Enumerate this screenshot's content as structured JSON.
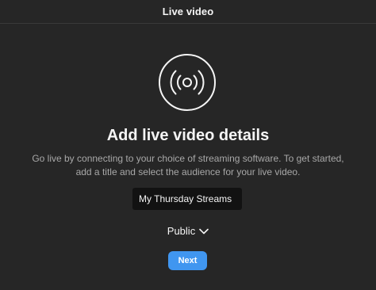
{
  "header": {
    "title": "Live video"
  },
  "icon": {
    "name": "live-broadcast-icon"
  },
  "main": {
    "heading": "Add live video details",
    "description": "Go live by connecting to your choice of streaming software. To get started, add a title and select the audience for your live video.",
    "title_input_value": "My Thursday Streams",
    "audience_label": "Public",
    "audience_icon": "chevron-down-icon",
    "next_label": "Next"
  },
  "colors": {
    "background": "#262626",
    "accent": "#4096f0",
    "input_background": "#121212",
    "secondary_text": "#a8a8a8"
  }
}
